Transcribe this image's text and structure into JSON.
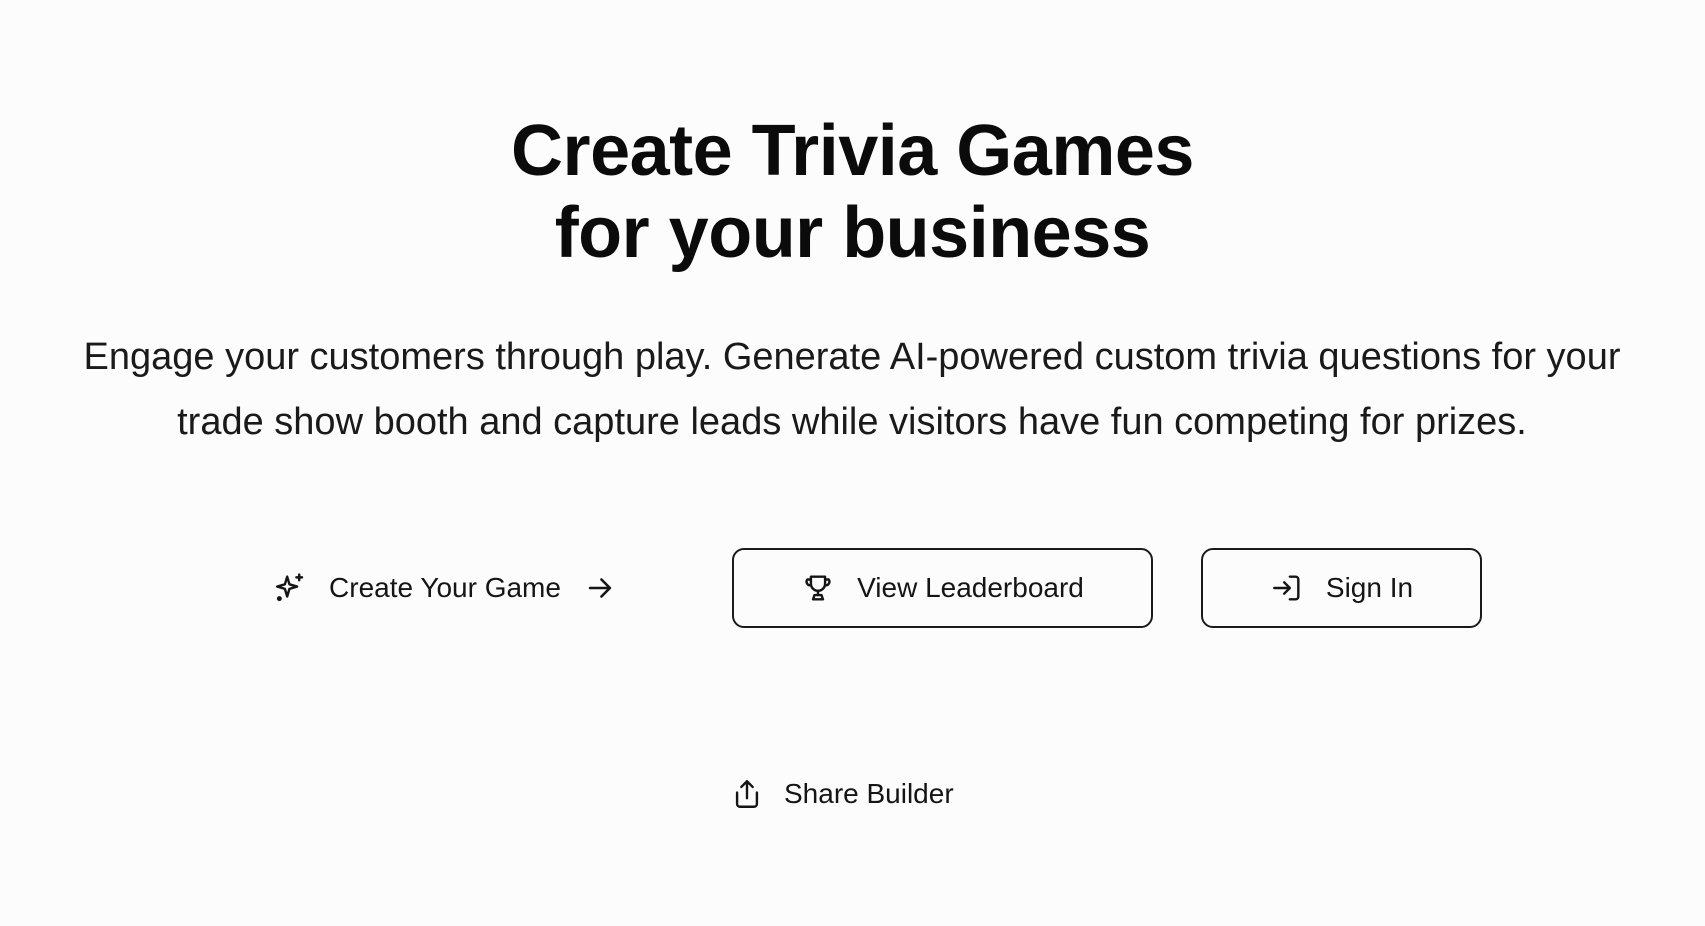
{
  "hero": {
    "title_line1": "Create Trivia Games",
    "title_line2": "for your business",
    "subtitle": "Engage your customers through play. Generate AI-powered custom trivia questions for your trade show booth and capture leads while visitors have fun competing for prizes."
  },
  "actions": {
    "create": {
      "label": "Create Your Game",
      "icon": "sparkles-icon",
      "trailing_icon": "arrow-right-icon"
    },
    "leaderboard": {
      "label": "View Leaderboard",
      "icon": "trophy-icon"
    },
    "signin": {
      "label": "Sign In",
      "icon": "sign-in-icon"
    }
  },
  "share": {
    "label": "Share Builder",
    "icon": "share-icon"
  },
  "colors": {
    "background": "#fcfcfc",
    "text": "#111111",
    "border": "#1a1a1a"
  }
}
